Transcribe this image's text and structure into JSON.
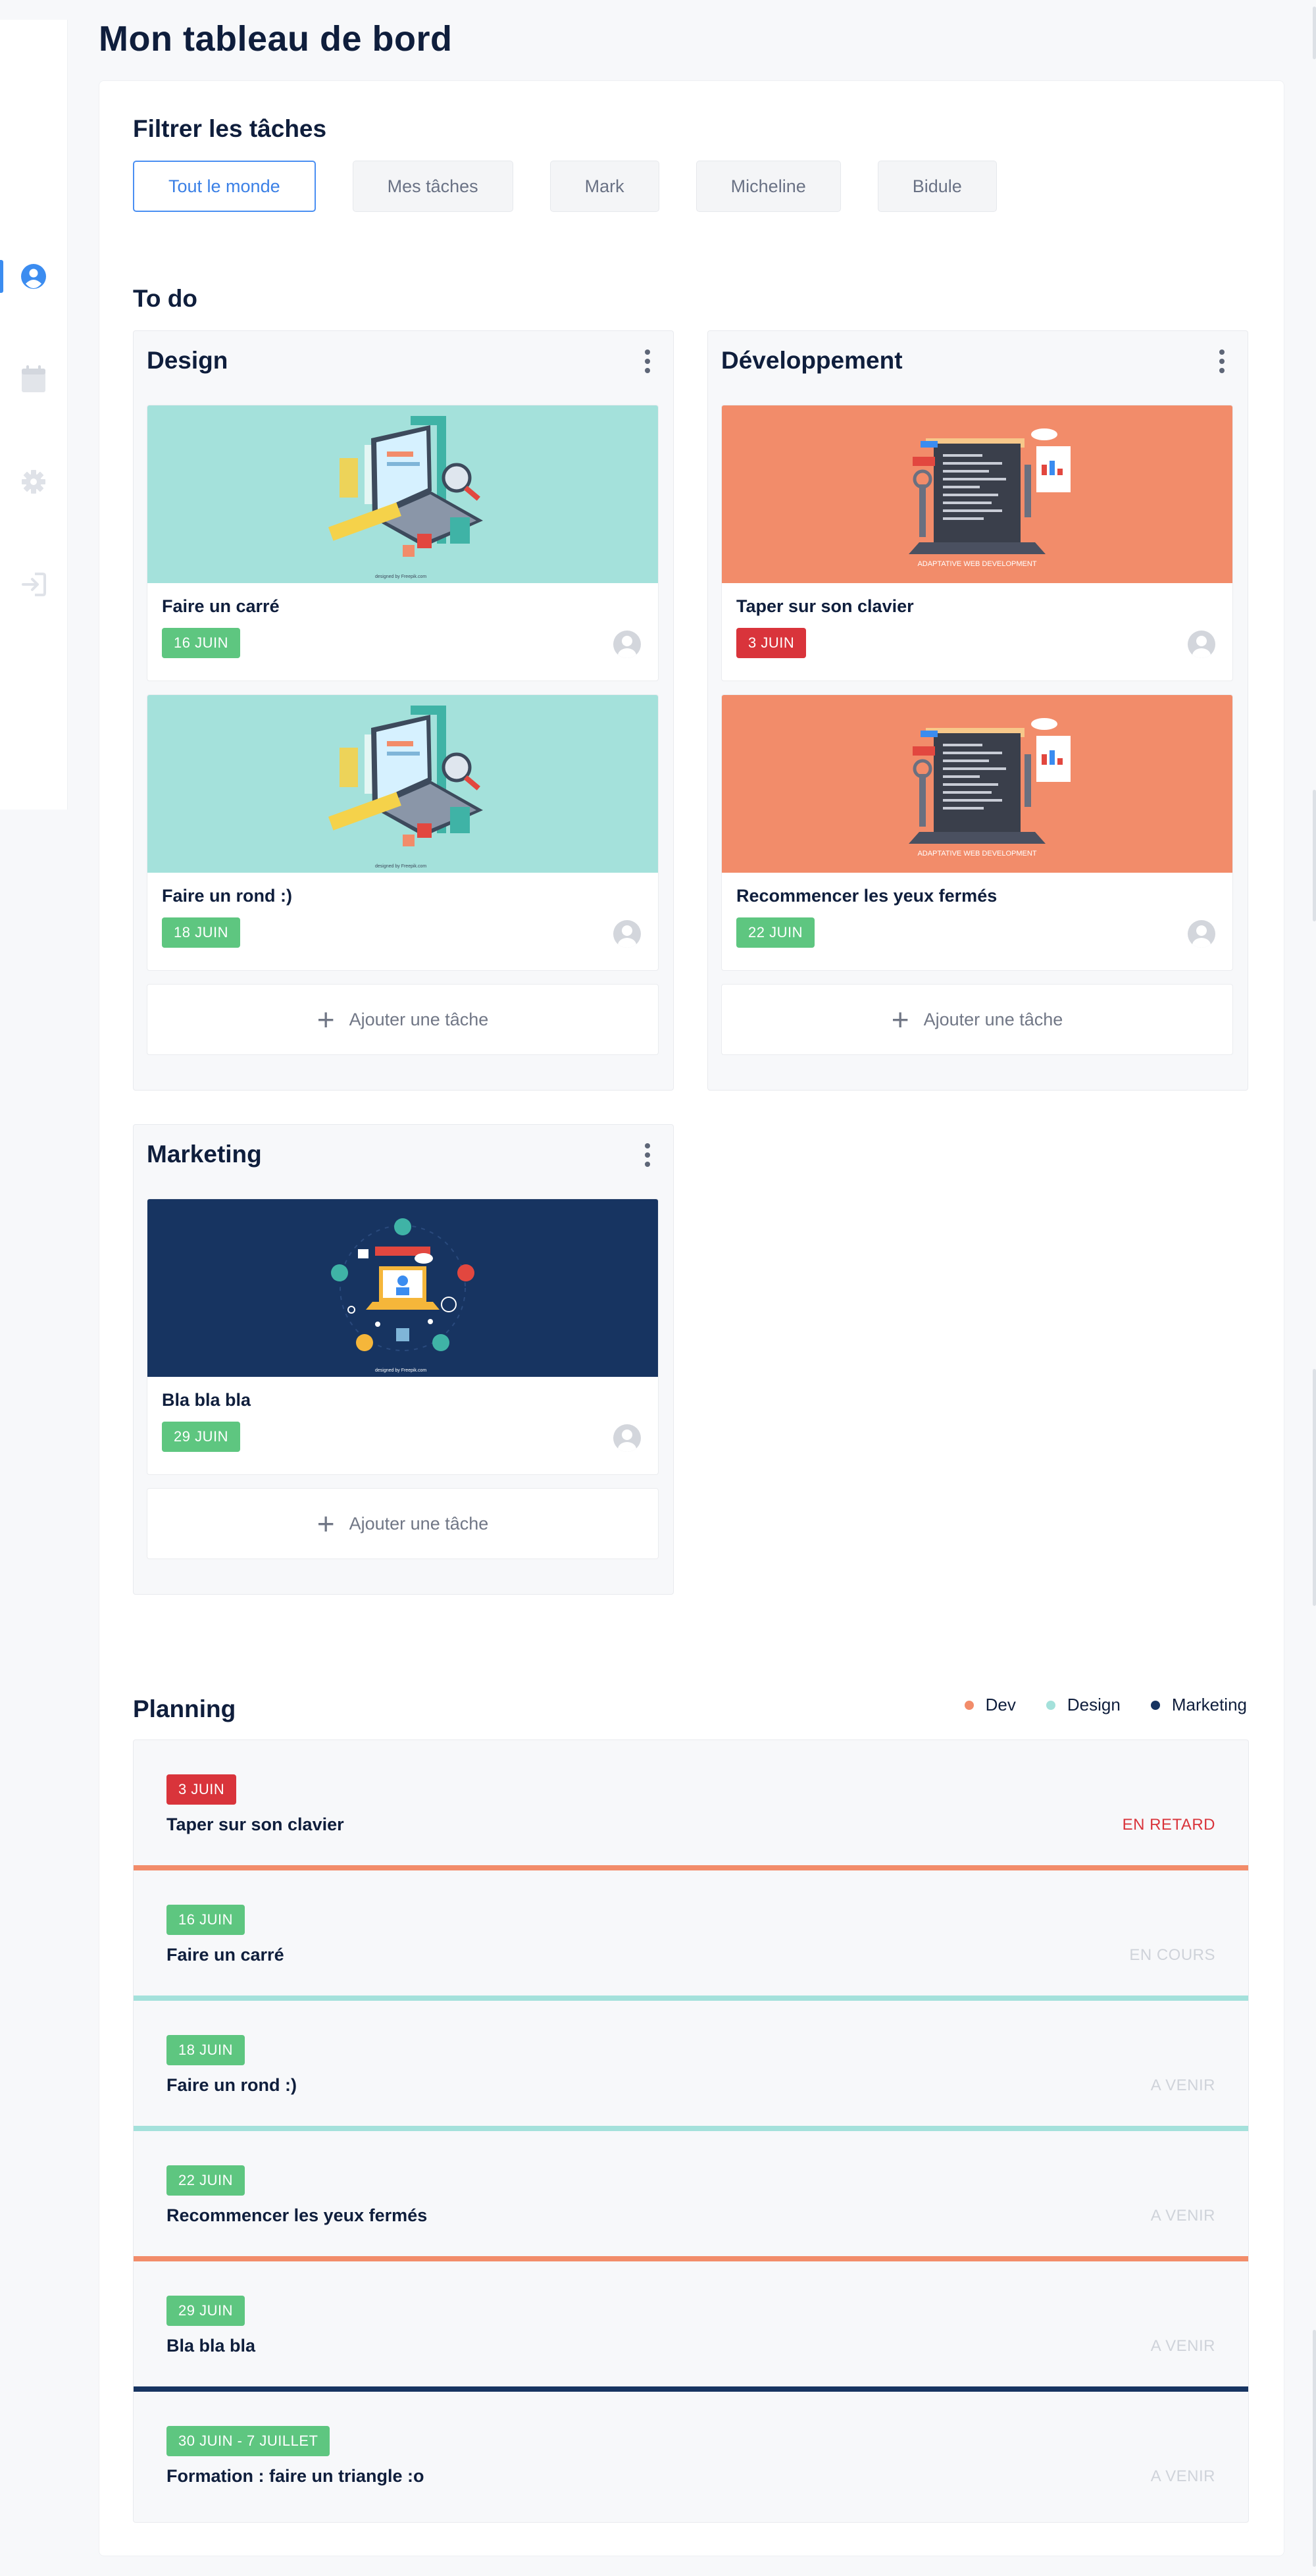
{
  "page_title": "Mon tableau de bord",
  "filter": {
    "title": "Filtrer les tâches",
    "buttons": [
      "Tout le monde",
      "Mes tâches",
      "Mark",
      "Micheline",
      "Bidule"
    ],
    "active": "Tout le monde"
  },
  "todo": {
    "title": "To do",
    "add_label": "Ajouter une tâche",
    "columns": [
      {
        "title": "Design",
        "cards": [
          {
            "title": "Faire un carré",
            "date": "16 JUIN",
            "status": "green",
            "image": "user-experience-illustration"
          },
          {
            "title": "Faire un rond :)",
            "date": "18 JUIN",
            "status": "green",
            "image": "user-experience-illustration"
          }
        ]
      },
      {
        "title": "Développement",
        "cards": [
          {
            "title": "Taper sur son clavier",
            "date": "3 JUIN",
            "status": "red",
            "image": "adaptative-web-development-illustration",
            "image_caption": "ADAPTATIVE WEB DEVELOPMENT"
          },
          {
            "title": "Recommencer les yeux fermés",
            "date": "22 JUIN",
            "status": "green",
            "image": "adaptative-web-development-illustration",
            "image_caption": "ADAPTATIVE WEB DEVELOPMENT"
          }
        ]
      },
      {
        "title": "Marketing",
        "cards": [
          {
            "title": "Bla bla bla",
            "date": "29 JUIN",
            "status": "green",
            "image": "influencer-marketing-illustration"
          }
        ]
      }
    ]
  },
  "planning": {
    "title": "Planning",
    "legend": [
      {
        "label": "Dev",
        "color": "#f28c6a"
      },
      {
        "label": "Design",
        "color": "#a4e1db"
      },
      {
        "label": "Marketing",
        "color": "#173461"
      }
    ],
    "rows": [
      {
        "date": "3 JUIN",
        "badge": "red",
        "title": "Taper sur son clavier",
        "status": "EN RETARD",
        "status_color": "#d9343b",
        "line": "#f28c6a"
      },
      {
        "date": "16 JUIN",
        "badge": "green",
        "title": "Faire un carré",
        "status": "EN COURS",
        "status_color": "#cfd3da",
        "line": "#a4e1db"
      },
      {
        "date": "18 JUIN",
        "badge": "green",
        "title": "Faire un rond :)",
        "status": "A VENIR",
        "status_color": "#cfd3da",
        "line": "#a4e1db"
      },
      {
        "date": "22 JUIN",
        "badge": "green",
        "title": "Recommencer les yeux fermés",
        "status": "A VENIR",
        "status_color": "#cfd3da",
        "line": "#f28c6a"
      },
      {
        "date": "29 JUIN",
        "badge": "green",
        "title": "Bla bla bla",
        "status": "A VENIR",
        "status_color": "#cfd3da",
        "line": "#173461"
      },
      {
        "date": "30 JUIN - 7 JUILLET",
        "badge": "green",
        "title": "Formation : faire un triangle :o",
        "status": "A VENIR",
        "status_color": "#cfd3da",
        "line": null
      }
    ]
  },
  "sidebar": {
    "items": [
      {
        "icon": "user-icon",
        "active": true
      },
      {
        "icon": "calendar-icon",
        "active": false
      },
      {
        "icon": "gear-icon",
        "active": false
      },
      {
        "icon": "logout-icon",
        "active": false
      }
    ]
  },
  "colors": {
    "accent": "#3b8cf0",
    "design": "#a4e1db",
    "dev": "#f28c6a",
    "marketing": "#173461",
    "late": "#d9343b",
    "ok": "#5ec680"
  }
}
